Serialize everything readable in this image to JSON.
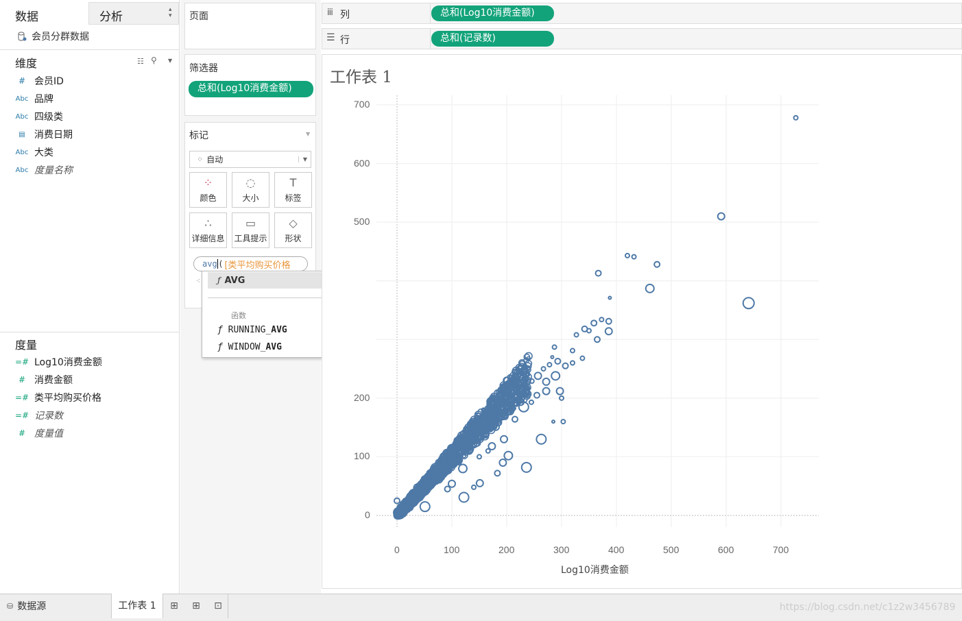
{
  "data_tab": "数据",
  "analysis_tab": "分析",
  "datasource_name": "会员分群数据",
  "dimensions_title": "维度",
  "dimensions": [
    {
      "icon": "#",
      "label": "会员ID",
      "italic": false
    },
    {
      "icon": "Abc",
      "label": "品牌",
      "italic": false
    },
    {
      "icon": "Abc",
      "label": "四级类",
      "italic": false
    },
    {
      "icon": "calendar-icon",
      "label": "消费日期",
      "italic": false
    },
    {
      "icon": "Abc",
      "label": "大类",
      "italic": false
    },
    {
      "icon": "Abc",
      "label": "度量名称",
      "italic": true
    }
  ],
  "measures_title": "度量",
  "measures": [
    {
      "label": "Log10消费金额",
      "italic": false
    },
    {
      "label": "消费金额",
      "italic": false
    },
    {
      "label": "类平均购买价格",
      "italic": false
    },
    {
      "label": "记录数",
      "italic": true
    },
    {
      "label": "度量值",
      "italic": true
    }
  ],
  "pages_label": "页面",
  "filters_label": "筛选器",
  "filter_pill": "总和(Log10消费金额)",
  "marks_label": "标记",
  "mark_type": "自动",
  "mark_buttons": [
    {
      "icon": "color-dots-icon",
      "label": "颜色"
    },
    {
      "icon": "size-icon",
      "label": "大小"
    },
    {
      "icon": "label-T-icon",
      "label": "标签"
    },
    {
      "icon": "detail-icon",
      "label": "详细信息"
    },
    {
      "icon": "tooltip-icon",
      "label": "工具提示"
    },
    {
      "icon": "shape-icon",
      "label": "形状"
    }
  ],
  "calc_typed": "avg",
  "calc_paren": "(",
  "calc_field": "[类平均购买价格",
  "autocomplete": {
    "top": "AVG",
    "section": "函数",
    "items": [
      {
        "prefix": "RUNNING_",
        "match": "AVG"
      },
      {
        "prefix": "WINDOW_",
        "match": "AVG"
      }
    ]
  },
  "columns_label": "列",
  "columns_pill": "总和(Log10消费金额)",
  "rows_label": "行",
  "rows_pill": "总和(记录数)",
  "sheet_title": "工作表 1",
  "bottom": {
    "datasource": "数据源",
    "sheet_tab": "工作表 1"
  },
  "watermark": "https://blog.csdn.net/c1z2w3456789",
  "chart_data": {
    "type": "scatter",
    "xlabel": "Log10消费金额",
    "xlim": [
      -40,
      770
    ],
    "ylim": [
      -10,
      720
    ],
    "xticks": [
      0,
      100,
      200,
      300,
      400,
      500,
      600,
      700
    ],
    "yticks": [
      0,
      100,
      200,
      500,
      600,
      700
    ],
    "grid": true,
    "mark_color": "#4e79a7",
    "dense_band": {
      "x_from": 0,
      "x_to": 240,
      "slope": 1.0,
      "note_points": 2000
    },
    "points": [
      {
        "x": 727,
        "y": 678,
        "s": 3
      },
      {
        "x": 591,
        "y": 510,
        "s": 5
      },
      {
        "x": 641,
        "y": 362,
        "s": 8
      },
      {
        "x": 461,
        "y": 387,
        "s": 6
      },
      {
        "x": 420,
        "y": 443,
        "s": 3
      },
      {
        "x": 432,
        "y": 441,
        "s": 3
      },
      {
        "x": 474,
        "y": 428,
        "s": 4
      },
      {
        "x": 367,
        "y": 413,
        "s": 4
      },
      {
        "x": 388,
        "y": 371,
        "s": 2
      },
      {
        "x": 386,
        "y": 331,
        "s": 4
      },
      {
        "x": 386,
        "y": 314,
        "s": 5
      },
      {
        "x": 365,
        "y": 300,
        "s": 4
      },
      {
        "x": 359,
        "y": 328,
        "s": 4
      },
      {
        "x": 373,
        "y": 334,
        "s": 3
      },
      {
        "x": 342,
        "y": 318,
        "s": 4
      },
      {
        "x": 350,
        "y": 315,
        "s": 3
      },
      {
        "x": 327,
        "y": 308,
        "s": 3
      },
      {
        "x": 320,
        "y": 281,
        "s": 3
      },
      {
        "x": 287,
        "y": 287,
        "s": 3
      },
      {
        "x": 283,
        "y": 270,
        "s": 2
      },
      {
        "x": 338,
        "y": 268,
        "s": 3
      },
      {
        "x": 320,
        "y": 260,
        "s": 3
      },
      {
        "x": 307,
        "y": 255,
        "s": 4
      },
      {
        "x": 289,
        "y": 238,
        "s": 6
      },
      {
        "x": 293,
        "y": 263,
        "s": 4
      },
      {
        "x": 297,
        "y": 212,
        "s": 5
      },
      {
        "x": 278,
        "y": 257,
        "s": 3
      },
      {
        "x": 267,
        "y": 250,
        "s": 3
      },
      {
        "x": 272,
        "y": 228,
        "s": 5
      },
      {
        "x": 257,
        "y": 238,
        "s": 5
      },
      {
        "x": 255,
        "y": 205,
        "s": 4
      },
      {
        "x": 246,
        "y": 229,
        "s": 3
      },
      {
        "x": 245,
        "y": 193,
        "s": 3
      },
      {
        "x": 238,
        "y": 207,
        "s": 5
      },
      {
        "x": 228,
        "y": 212,
        "s": 5
      },
      {
        "x": 222,
        "y": 218,
        "s": 3
      },
      {
        "x": 210,
        "y": 205,
        "s": 3
      },
      {
        "x": 303,
        "y": 160,
        "s": 3
      },
      {
        "x": 285,
        "y": 160,
        "s": 2
      },
      {
        "x": 300,
        "y": 200,
        "s": 3
      },
      {
        "x": 263,
        "y": 130,
        "s": 7
      },
      {
        "x": 236,
        "y": 82,
        "s": 7
      },
      {
        "x": 195,
        "y": 130,
        "s": 5
      },
      {
        "x": 203,
        "y": 102,
        "s": 6
      },
      {
        "x": 193,
        "y": 90,
        "s": 5
      },
      {
        "x": 151,
        "y": 55,
        "s": 5
      },
      {
        "x": 140,
        "y": 48,
        "s": 3
      },
      {
        "x": 122,
        "y": 31,
        "s": 7
      },
      {
        "x": 51,
        "y": 15,
        "s": 7
      },
      {
        "x": 0,
        "y": 25,
        "s": 4
      },
      {
        "x": 173,
        "y": 118,
        "s": 5
      },
      {
        "x": 120,
        "y": 80,
        "s": 6
      },
      {
        "x": 231,
        "y": 185,
        "s": 7
      },
      {
        "x": 150,
        "y": 100,
        "s": 3
      },
      {
        "x": 215,
        "y": 164,
        "s": 4
      },
      {
        "x": 202,
        "y": 176,
        "s": 4
      },
      {
        "x": 180,
        "y": 151,
        "s": 5
      },
      {
        "x": 100,
        "y": 54,
        "s": 5
      },
      {
        "x": 272,
        "y": 212,
        "s": 5
      },
      {
        "x": 183,
        "y": 72,
        "s": 4
      },
      {
        "x": 92,
        "y": 45,
        "s": 4
      },
      {
        "x": 166,
        "y": 110,
        "s": 3
      }
    ]
  }
}
